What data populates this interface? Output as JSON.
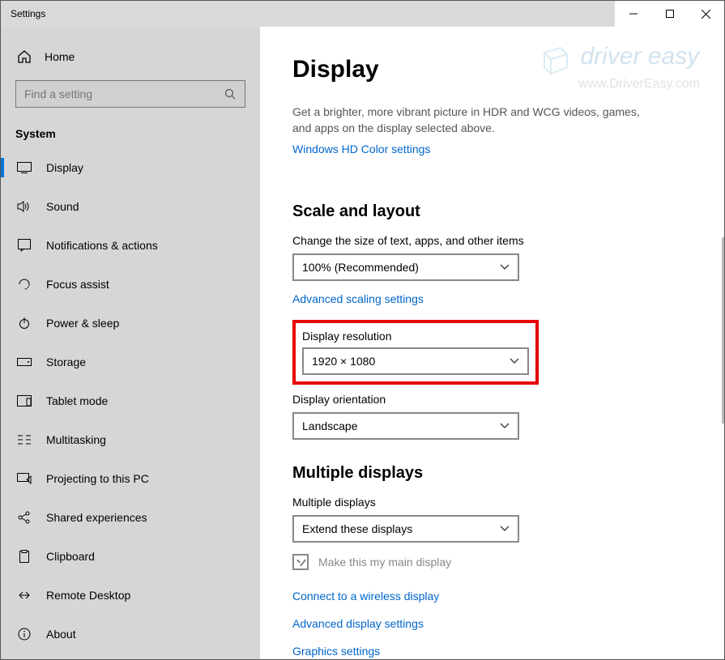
{
  "window": {
    "title": "Settings"
  },
  "sidebar": {
    "home": "Home",
    "search_placeholder": "Find a setting",
    "section": "System",
    "items": [
      {
        "label": "Display"
      },
      {
        "label": "Sound"
      },
      {
        "label": "Notifications & actions"
      },
      {
        "label": "Focus assist"
      },
      {
        "label": "Power & sleep"
      },
      {
        "label": "Storage"
      },
      {
        "label": "Tablet mode"
      },
      {
        "label": "Multitasking"
      },
      {
        "label": "Projecting to this PC"
      },
      {
        "label": "Shared experiences"
      },
      {
        "label": "Clipboard"
      },
      {
        "label": "Remote Desktop"
      },
      {
        "label": "About"
      }
    ]
  },
  "main": {
    "heading": "Display",
    "hdr_desc": "Get a brighter, more vibrant picture in HDR and WCG videos, games, and apps on the display selected above.",
    "hdr_link": "Windows HD Color settings",
    "scale_heading": "Scale and layout",
    "scale_label": "Change the size of text, apps, and other items",
    "scale_value": "100% (Recommended)",
    "adv_scale_link": "Advanced scaling settings",
    "res_label": "Display resolution",
    "res_value": "1920 × 1080",
    "orient_label": "Display orientation",
    "orient_value": "Landscape",
    "multi_heading": "Multiple displays",
    "multi_label": "Multiple displays",
    "multi_value": "Extend these displays",
    "make_main": "Make this my main display",
    "link_wireless": "Connect to a wireless display",
    "link_adv": "Advanced display settings",
    "link_graphics": "Graphics settings"
  },
  "watermark": {
    "brand": "driver easy",
    "url": "www.DriverEasy.com"
  }
}
